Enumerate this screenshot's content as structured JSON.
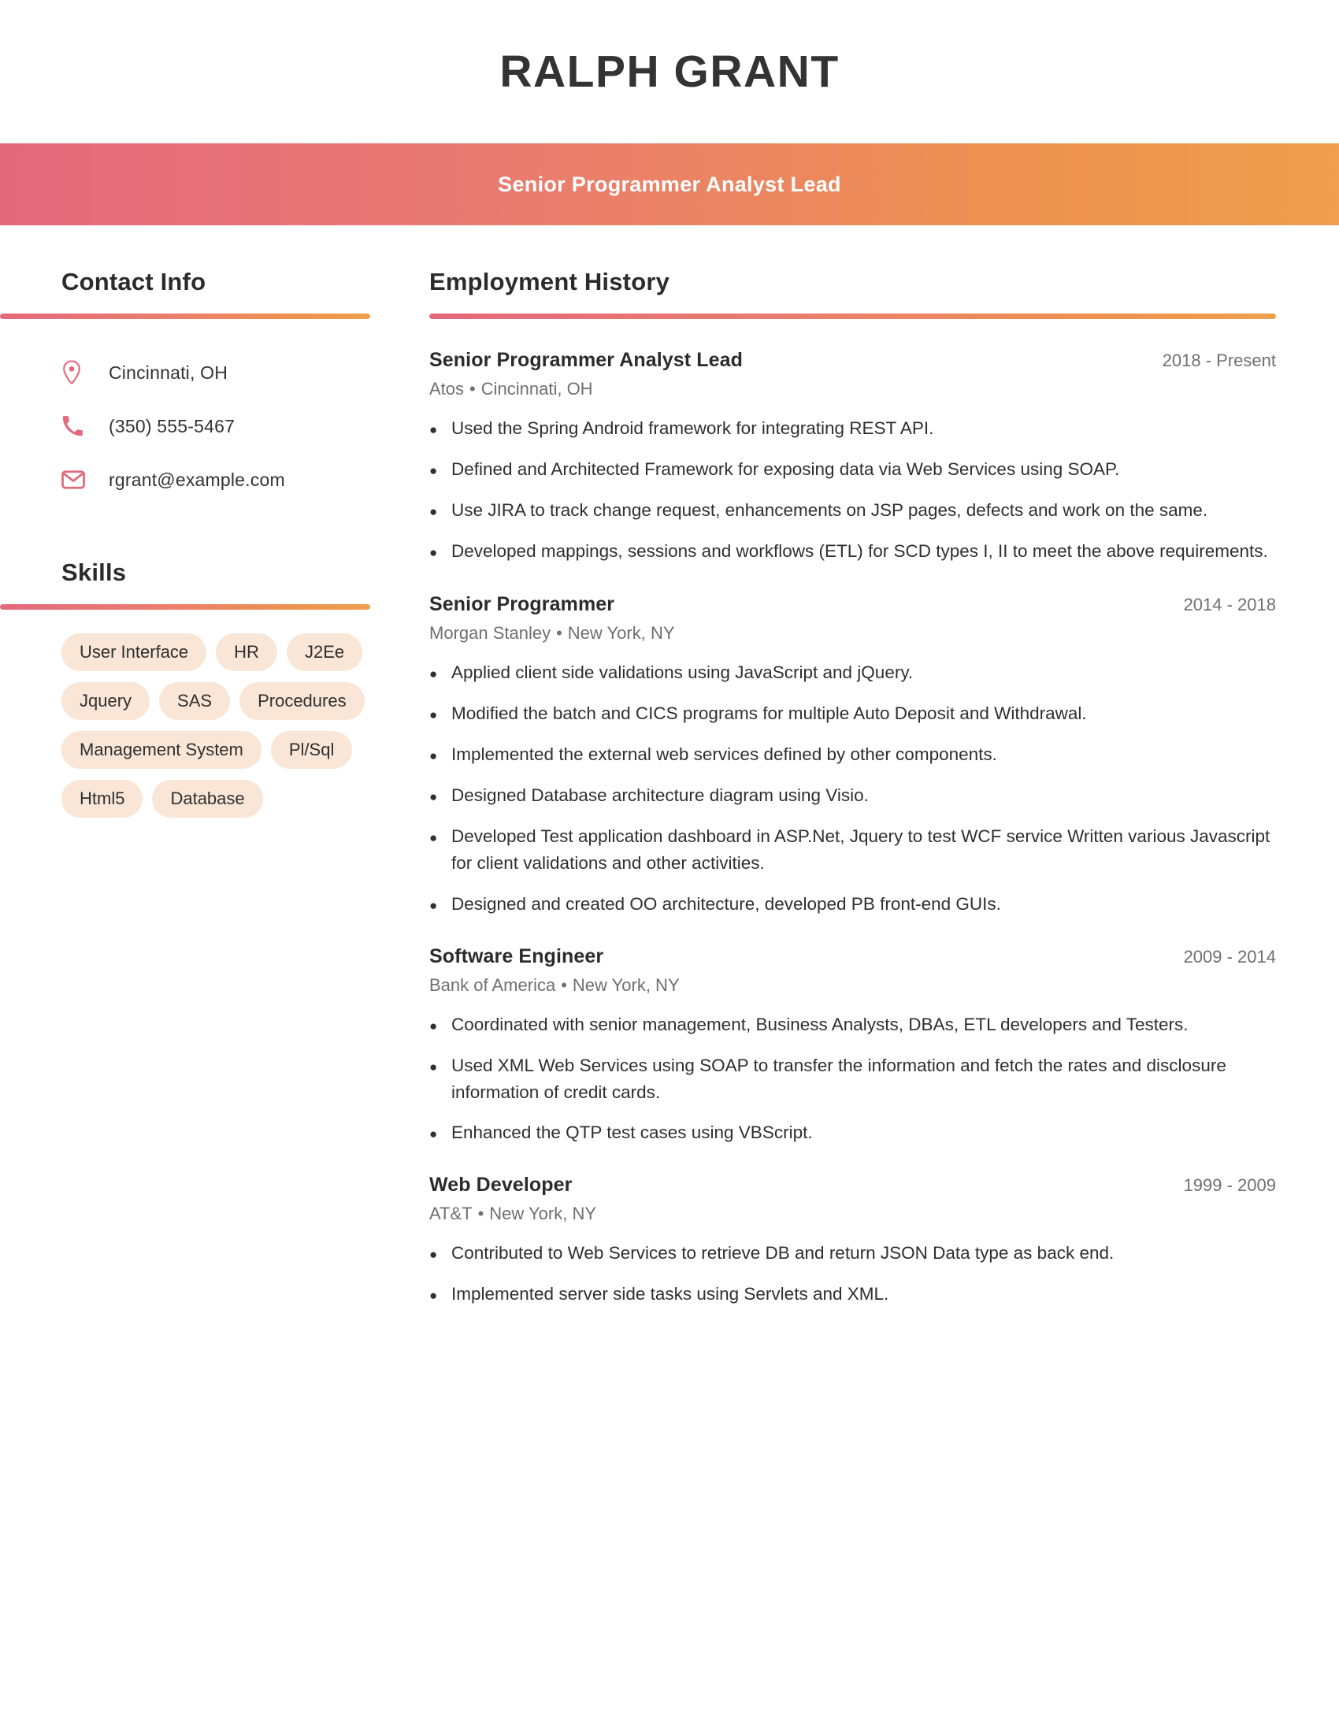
{
  "header": {
    "name": "RALPH GRANT",
    "role": "Senior Programmer Analyst Lead",
    "gradient_start": "#e4687c",
    "gradient_end": "#ef9f4e"
  },
  "sidebar": {
    "contact": {
      "heading": "Contact Info",
      "items": [
        {
          "icon": "location-pin-icon",
          "value": "Cincinnati, OH"
        },
        {
          "icon": "phone-icon",
          "value": "(350) 555-5467"
        },
        {
          "icon": "envelope-icon",
          "value": "rgrant@example.com"
        }
      ]
    },
    "skills": {
      "heading": "Skills",
      "pill_bg": "#fae6d6",
      "items": [
        "User Interface",
        "HR",
        "J2Ee",
        "Jquery",
        "SAS",
        "Procedures",
        "Management System",
        "Pl/Sql",
        "Html5",
        "Database"
      ]
    }
  },
  "main": {
    "heading": "Employment History",
    "jobs": [
      {
        "title": "Senior Programmer Analyst Lead",
        "dates": "2018 - Present",
        "company": "Atos",
        "location": "Cincinnati, OH",
        "bullets": [
          "Used the Spring Android framework for integrating REST API.",
          "Defined and Architected Framework for exposing data via Web Services using SOAP.",
          "Use JIRA to track change request, enhancements on JSP pages, defects and work on the same.",
          "Developed mappings, sessions and workflows (ETL) for SCD types I, II to meet the above requirements."
        ]
      },
      {
        "title": "Senior Programmer",
        "dates": "2014 - 2018",
        "company": "Morgan Stanley",
        "location": "New York, NY",
        "bullets": [
          "Applied client side validations using JavaScript and jQuery.",
          "Modified the batch and CICS programs for multiple Auto Deposit and Withdrawal.",
          "Implemented the external web services defined by other components.",
          "Designed Database architecture diagram using Visio.",
          "Developed Test application dashboard in ASP.Net, Jquery to test WCF service Written various Javascript for client validations and other activities.",
          "Designed and created OO architecture, developed PB front-end GUIs."
        ]
      },
      {
        "title": "Software Engineer",
        "dates": "2009 - 2014",
        "company": "Bank of America",
        "location": "New York, NY",
        "bullets": [
          "Coordinated with senior management, Business Analysts, DBAs, ETL developers and Testers.",
          "Used XML Web Services using SOAP to transfer the information and fetch the rates and disclosure information of credit cards.",
          "Enhanced the QTP test cases using VBScript."
        ]
      },
      {
        "title": "Web Developer",
        "dates": "1999 - 2009",
        "company": "AT&T",
        "location": "New York, NY",
        "bullets": [
          "Contributed to Web Services to retrieve DB and return JSON Data type as back end.",
          "Implemented server side tasks using Servlets and XML."
        ]
      }
    ],
    "meta_separator": "•",
    "bullet_glyph": "●"
  }
}
